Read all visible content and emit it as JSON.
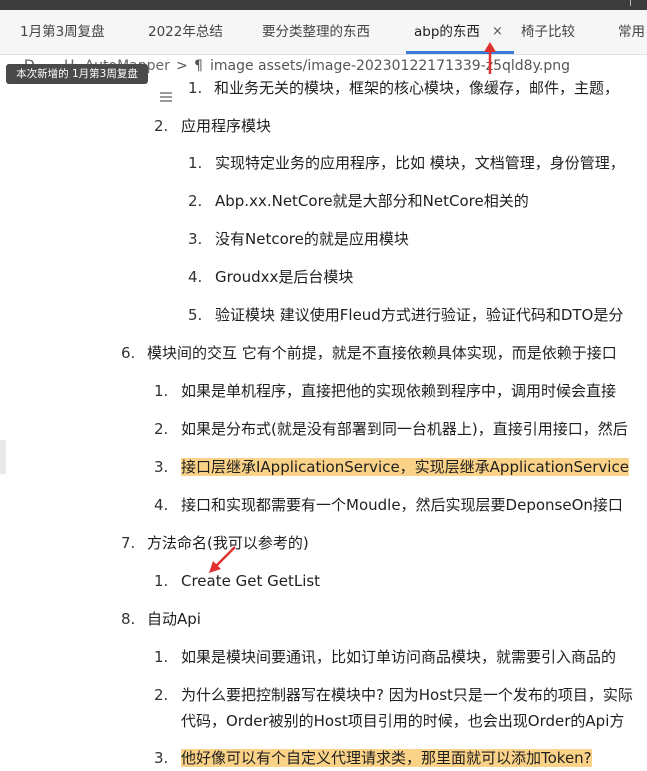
{
  "tabs": [
    {
      "label": "1月第3周复盘"
    },
    {
      "label": "2022年总结"
    },
    {
      "label": "要分类整理的东西"
    },
    {
      "label": "abp的东西"
    },
    {
      "label": "椅子比较"
    },
    {
      "label": "常用"
    }
  ],
  "active_tab_close": "×",
  "breadcrumb": {
    "doc_glyph": "D",
    "heading_part": "H₃ AutoMapper",
    "separator": ">",
    "para_glyph": "¶",
    "file": "image assets/image-20230122171339-z5qld8y.png"
  },
  "tooltip": "本次新增的 1月第3周复盘",
  "lines": [
    {
      "num": "1.",
      "text": "和业务无关的模块，框架的核心模块，像缓存，邮件，主题，",
      "highlight": false
    },
    {
      "num": "2.",
      "text": "应用程序模块",
      "highlight": false
    },
    {
      "num": "1.",
      "text": "实现特定业务的应用程序，比如 模块，文档管理，身份管理，",
      "highlight": false
    },
    {
      "num": "2.",
      "text": "Abp.xx.NetCore就是大部分和NetCore相关的",
      "highlight": false
    },
    {
      "num": "3.",
      "text": "没有Netcore的就是应用模块",
      "highlight": false
    },
    {
      "num": "4.",
      "text": "Groudxx是后台模块",
      "highlight": false
    },
    {
      "num": "5.",
      "text": "验证模块 建议使用Fleud方式进行验证，验证代码和DTO是分",
      "highlight": false
    },
    {
      "num": "6.",
      "text": "模块间的交互  它有个前提，就是不直接依赖具体实现，而是依赖于接口",
      "highlight": false
    },
    {
      "num": "1.",
      "text": "如果是单机程序，直接把他的实现依赖到程序中，调用时候会直接",
      "highlight": false
    },
    {
      "num": "2.",
      "text": "如果是分布式(就是没有部署到同一台机器上)，直接引用接口，然后",
      "highlight": false
    },
    {
      "num": "3.",
      "text": " 接口层继承IApplicationService，实现层继承ApplicationService",
      "highlight": true
    },
    {
      "num": "4.",
      "text": "接口和实现都需要有一个Moudle，然后实现层要DeponseOn接口",
      "highlight": false
    },
    {
      "num": "7.",
      "text": "方法命名(我可以参考的)",
      "highlight": false
    },
    {
      "num": "1.",
      "text": "Create   Get GetList",
      "highlight": false
    },
    {
      "num": "8.",
      "text": "自动Api",
      "highlight": false
    },
    {
      "num": "1.",
      "text": "如果是模块间要通讯，比如订单访问商品模块，就需要引入商品的",
      "highlight": false
    },
    {
      "num": "2.",
      "text": "为什么要把控制器写在模块中? 因为Host只是一个发布的项目，实际",
      "highlight": false
    },
    {
      "num": "",
      "text": "代码，Order被别的Host项目引用的时候，也会出现Order的Api方",
      "highlight": false
    },
    {
      "num": "3.",
      "text": "他好像可以有个自定义代理请求类，那里面就可以添加Token?",
      "highlight": true
    }
  ],
  "colors": {
    "highlight": "#fbd388",
    "arrow": "#e03030",
    "tab_underline": "#3a7bd5"
  }
}
